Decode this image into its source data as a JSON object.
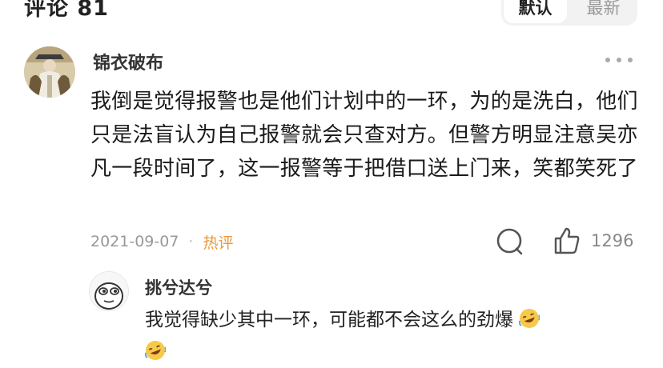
{
  "header": {
    "title": "评论 81",
    "sort_default": "默认",
    "sort_latest": "最新"
  },
  "comment": {
    "username": "锦衣破布",
    "text": "我倒是觉得报警也是他们计划中的一环，为的是洗白，他们只是法盲认为自己报警就会只查对方。但警方明显注意吴亦凡一段时间了，这一报警等于把借口送上门来，笑都笑死了",
    "date": "2021-09-07",
    "dot": "·",
    "hot_label": "热评",
    "like_count": "1296"
  },
  "reply": {
    "username": "挑兮达兮",
    "text": "我觉得缺少其中一环，可能都不会这么的劲爆"
  },
  "colors": {
    "accent_hot": "#e8983a",
    "muted": "#999999",
    "emoji_yellow": "#f7c84a"
  }
}
